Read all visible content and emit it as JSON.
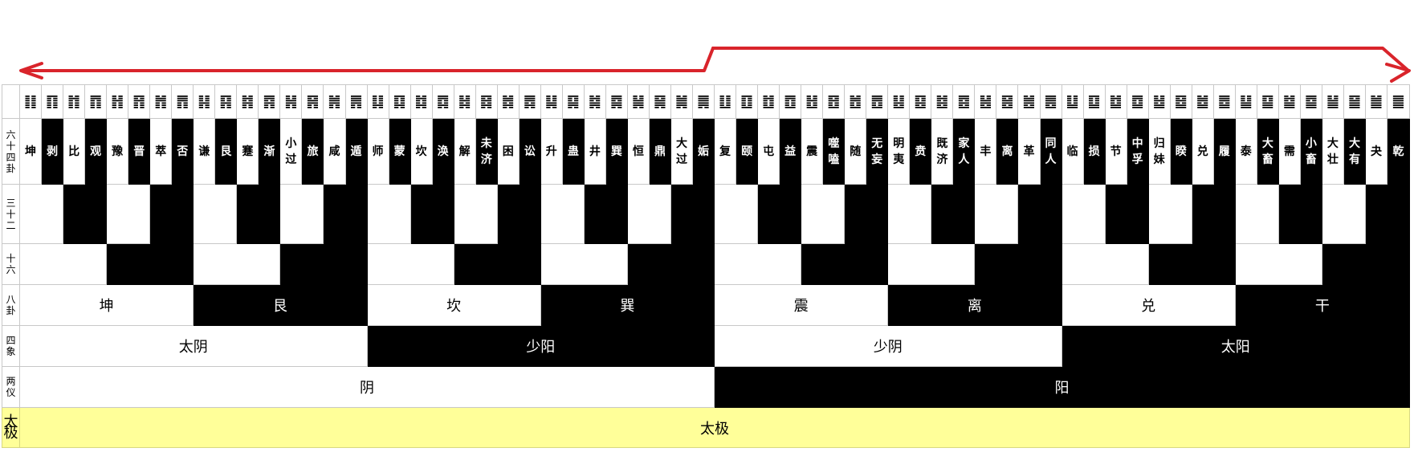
{
  "colors": {
    "arrow": "#d9242b",
    "black": "#000000",
    "white": "#ffffff",
    "taiji_bg": "#ffff99"
  },
  "row_labels": {
    "hexagrams": "六十四卦",
    "thirty_two": "三十二",
    "sixteen": "十六",
    "trigrams": "八卦",
    "four_images": "四象",
    "two_modes": "两仪",
    "taiji": "太极"
  },
  "hex_symbols": [
    "䷁",
    "䷖",
    "䷇",
    "䷓",
    "䷏",
    "䷢",
    "䷬",
    "䷋",
    "䷎",
    "䷳",
    "䷦",
    "䷴",
    "䷽",
    "䷷",
    "䷞",
    "䷠",
    "䷆",
    "䷃",
    "䷜",
    "䷺",
    "䷧",
    "䷿",
    "䷮",
    "䷅",
    "䷭",
    "䷑",
    "䷯",
    "䷸",
    "䷟",
    "䷱",
    "䷛",
    "䷫",
    "䷗",
    "䷚",
    "䷂",
    "䷩",
    "䷲",
    "䷔",
    "䷐",
    "䷘",
    "䷣",
    "䷕",
    "䷾",
    "䷤",
    "䷶",
    "䷝",
    "䷰",
    "䷌",
    "䷒",
    "䷨",
    "䷻",
    "䷼",
    "䷵",
    "䷥",
    "䷹",
    "䷉",
    "䷊",
    "䷙",
    "䷄",
    "䷈",
    "䷡",
    "䷍",
    "䷪",
    "䷀"
  ],
  "hex_names": [
    "坤",
    "剥",
    "比",
    "观",
    "豫",
    "晋",
    "萃",
    "否",
    "谦",
    "艮",
    "蹇",
    "渐",
    "小过",
    "旅",
    "咸",
    "遁",
    "师",
    "蒙",
    "坎",
    "涣",
    "解",
    "未济",
    "困",
    "讼",
    "升",
    "蛊",
    "井",
    "巽",
    "恒",
    "鼎",
    "大过",
    "姤",
    "复",
    "颐",
    "屯",
    "益",
    "震",
    "噬嗑",
    "随",
    "无妄",
    "明夷",
    "贲",
    "既济",
    "家人",
    "丰",
    "离",
    "革",
    "同人",
    "临",
    "损",
    "节",
    "中孚",
    "归妹",
    "睽",
    "兑",
    "履",
    "泰",
    "大畜",
    "需",
    "小畜",
    "大壮",
    "大有",
    "夬",
    "乾"
  ],
  "trigrams": [
    "坤",
    "艮",
    "坎",
    "巽",
    "震",
    "离",
    "兑",
    "干"
  ],
  "four_images": [
    "太阴",
    "少阳",
    "少阴",
    "太阳"
  ],
  "two_modes": [
    "阴",
    "阳"
  ],
  "taiji": "太极"
}
